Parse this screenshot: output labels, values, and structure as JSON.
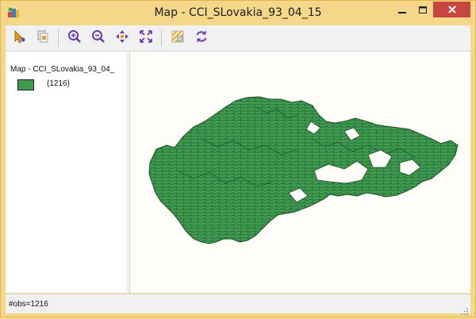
{
  "window": {
    "title": "Map - CCI_SLovakia_93_04_15",
    "app_icon": "geoda-icon",
    "controls": [
      "minimize-icon",
      "maximize-icon",
      "close-icon"
    ]
  },
  "toolbar": {
    "icons": [
      "select-arrow-icon",
      "select-copy-icon",
      "zoom-in-icon",
      "zoom-out-icon",
      "pan-icon",
      "fit-extent-icon",
      "map-layer-icon",
      "refresh-icon"
    ]
  },
  "legend": {
    "title": "Map - CCI_SLovakia_93_04_",
    "items": [
      {
        "label": "(1216)",
        "color": "#3d9a4f"
      }
    ]
  },
  "map": {
    "fill_color": "#3d9a4f",
    "background": "#fffdf7"
  },
  "status": {
    "text": "#obs=1216"
  }
}
